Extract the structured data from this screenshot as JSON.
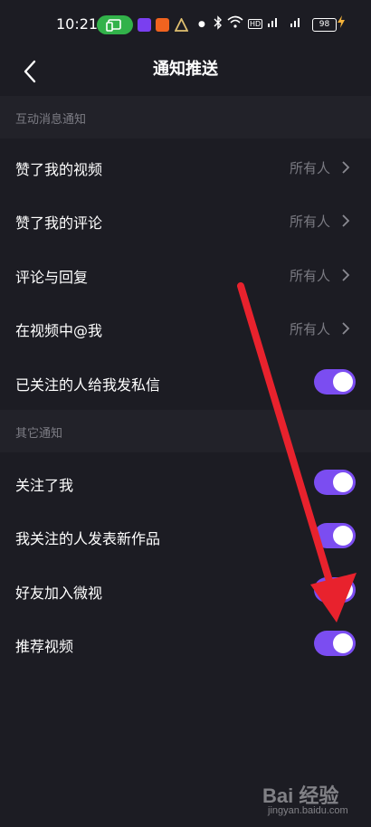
{
  "statusbar": {
    "time": "10:21",
    "battery": "98",
    "hd_label": "HD"
  },
  "navbar": {
    "back_icon": "chevron-left-icon",
    "title": "通知推送"
  },
  "sections": [
    {
      "title": "互动消息通知",
      "rows": [
        {
          "label": "赞了我的视频",
          "value": "所有人"
        },
        {
          "label": "赞了我的评论",
          "value": "所有人"
        },
        {
          "label": "评论与回复",
          "value": "所有人"
        },
        {
          "label": "在视频中@我",
          "value": "所有人"
        },
        {
          "label": "已关注的人给我发私信",
          "toggle": true
        }
      ]
    },
    {
      "title": "其它通知",
      "rows": [
        {
          "label": "关注了我",
          "toggle": true
        },
        {
          "label": "我关注的人发表新作品",
          "toggle": true
        },
        {
          "label": "好友加入微视",
          "toggle": true
        },
        {
          "label": "推荐视频",
          "toggle": true
        }
      ]
    }
  ],
  "watermark": {
    "brand": "Bai 经验",
    "url": "jingyan.baidu.com"
  },
  "colors": {
    "background": "#1c1c23",
    "section_header": "#222229",
    "toggle_on": "#7b4df1",
    "annotation_arrow": "#e8222d"
  }
}
